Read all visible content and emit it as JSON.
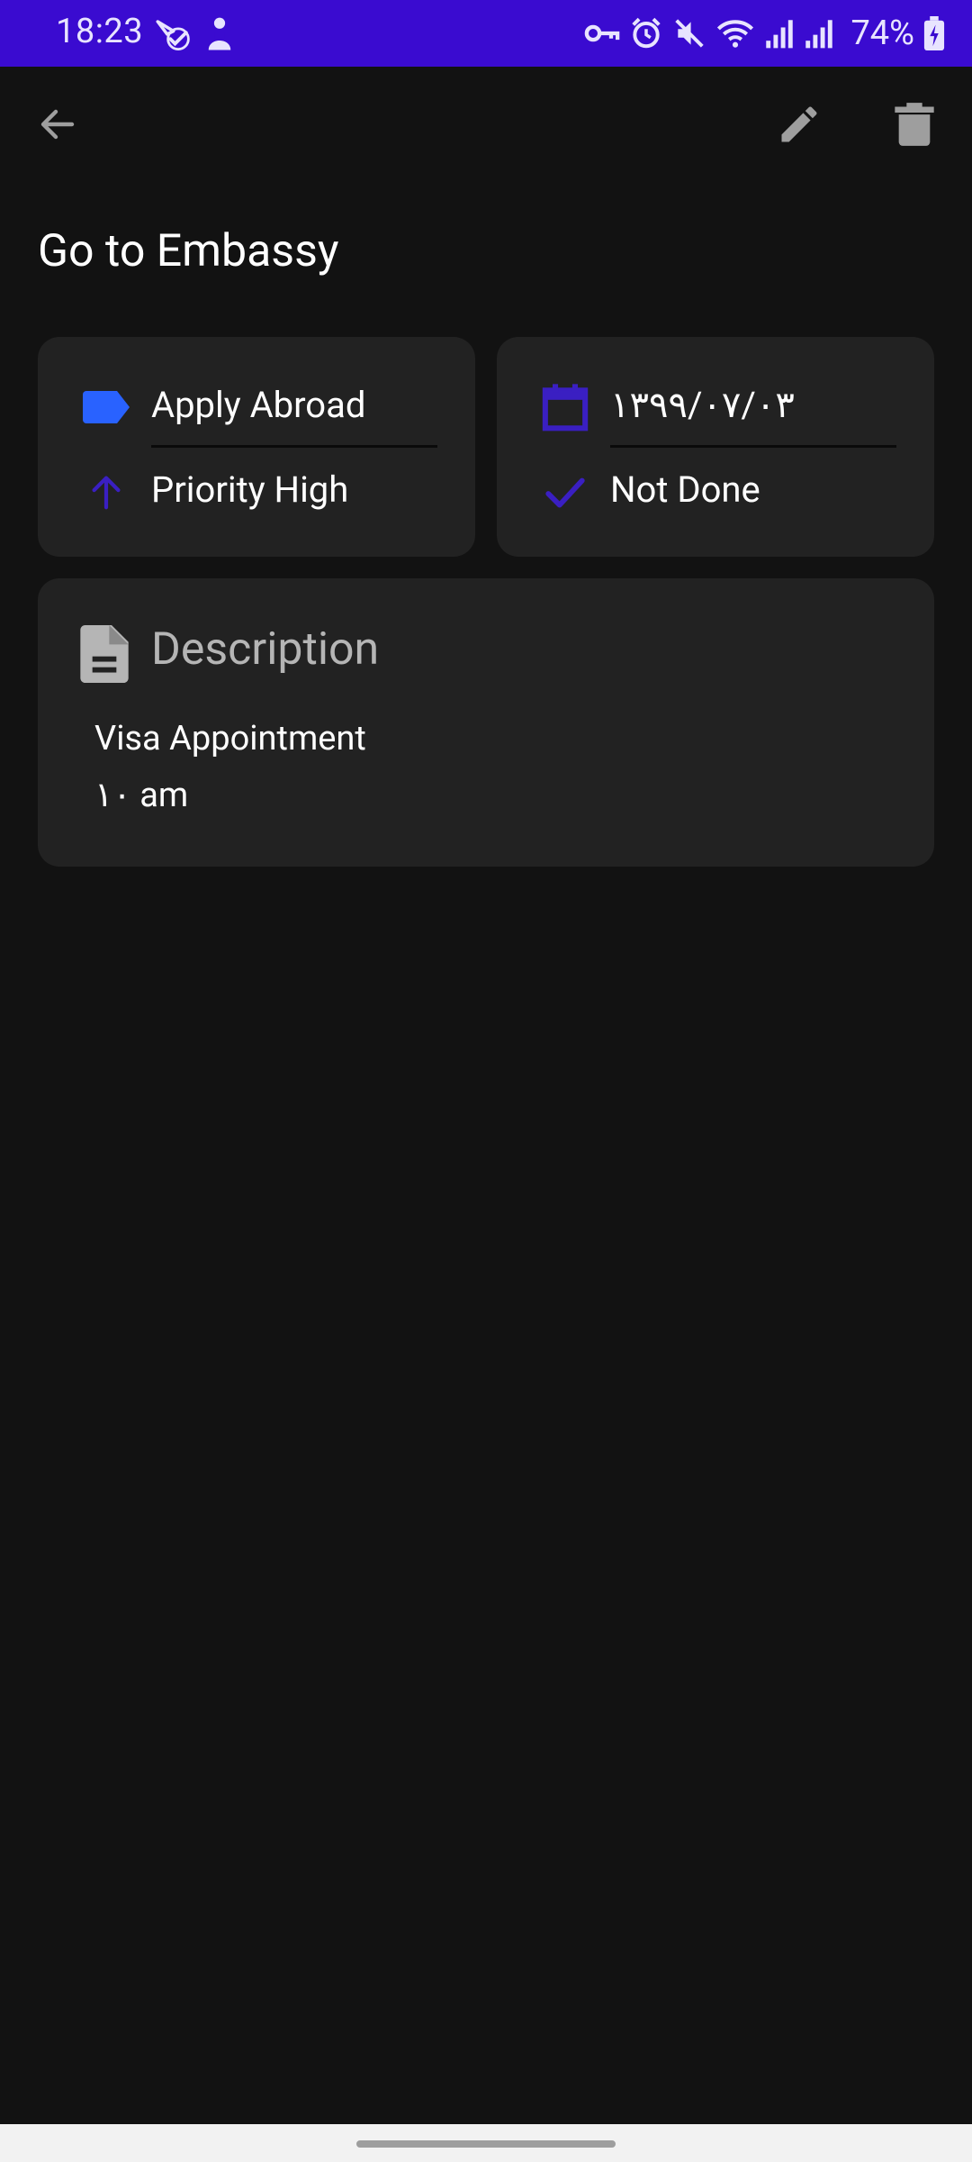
{
  "status_bar": {
    "time": "18:23",
    "battery": "74%",
    "left_icons": [
      "share-check-icon",
      "person-icon"
    ],
    "right_icons": [
      "vpn-key-icon",
      "alarm-icon",
      "mute-icon",
      "wifi-icon",
      "signal-icon",
      "signal-icon",
      "battery-charging-icon"
    ]
  },
  "app_bar": {
    "back_icon": "arrow-back-icon",
    "edit_icon": "pencil-icon",
    "delete_icon": "trash-icon"
  },
  "task": {
    "title": "Go to Embassy",
    "category": "Apply Abroad",
    "priority": "Priority High",
    "date": "۱۳۹۹/۰۷/۰۳",
    "status": "Not Done",
    "description_header": "Description",
    "description_lines": [
      "Visa Appointment",
      "۱۰ am"
    ]
  },
  "colors": {
    "status_bar": "#3a0bd0",
    "background": "#121212",
    "card": "#222222",
    "accent_purple": "#3a1fc2",
    "tag_blue": "#2962ff",
    "icon_grey": "#9e9e9e"
  }
}
